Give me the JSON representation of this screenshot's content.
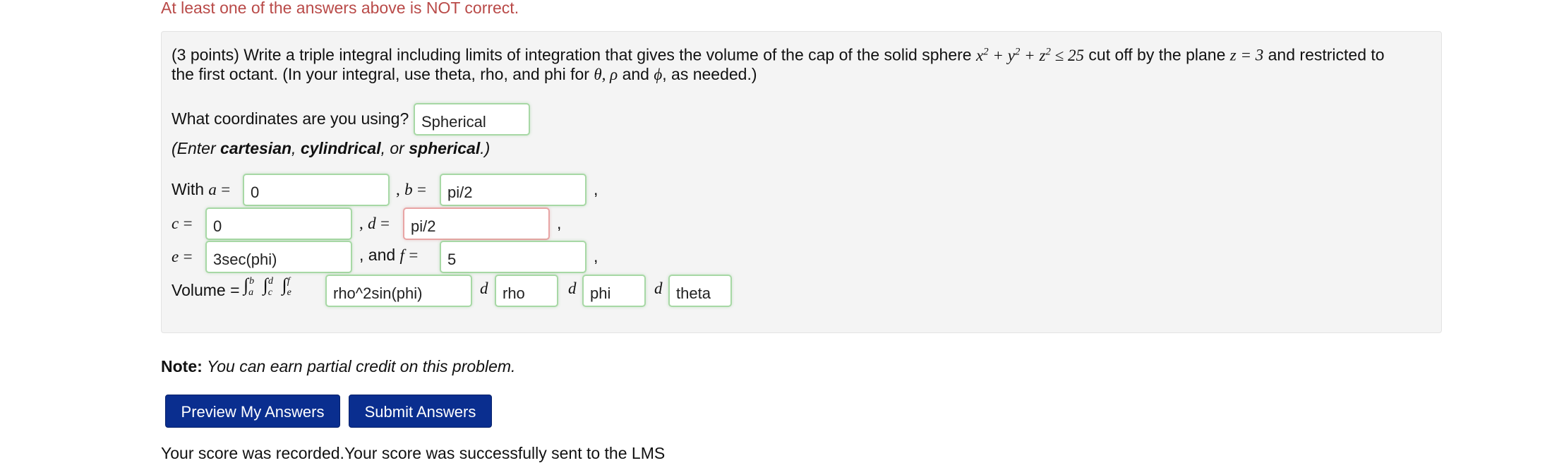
{
  "feedback_message": "At least one of the answers above is NOT correct.",
  "problem": {
    "points": "(3 points)",
    "statement_part1": "Write a triple integral including limits of integration that gives the volume of the cap of the solid sphere",
    "statement_part2": "cut off by the plane",
    "statement_part3": "and restricted to",
    "statement_line2": "the first octant. (In your integral, use theta, rho, and phi for",
    "statement_line2_end": ", as needed.)",
    "coord_question": "What coordinates are you using?",
    "coord_answer": "Spherical",
    "coord_hint_prefix": "(Enter ",
    "coord_hint_opt1": "cartesian",
    "coord_hint_opt2": "cylindrical",
    "coord_hint_or": ", or ",
    "coord_hint_opt3": "spherical",
    "coord_hint_suffix": ".)",
    "with_label": "With",
    "and_label": ", and",
    "volume_label": "Volume =",
    "answers": {
      "a": "0",
      "b": "pi/2",
      "c": "0",
      "d": "pi/2",
      "e": "3sec(phi)",
      "f": "5",
      "integrand": "rho^2sin(phi)",
      "d1": "rho",
      "d2": "phi",
      "d3": "theta"
    }
  },
  "note_label": "Note:",
  "note_text": "You can earn partial credit on this problem.",
  "buttons": {
    "preview": "Preview My Answers",
    "submit": "Submit Answers"
  },
  "status_message": "Your score was recorded.Your score was successfully sent to the LMS",
  "colors": {
    "error_text": "#b94a48",
    "button_bg": "#0a2e8f",
    "correct_border": "#a7d8a5",
    "incorrect_border": "#e8a4a4"
  }
}
